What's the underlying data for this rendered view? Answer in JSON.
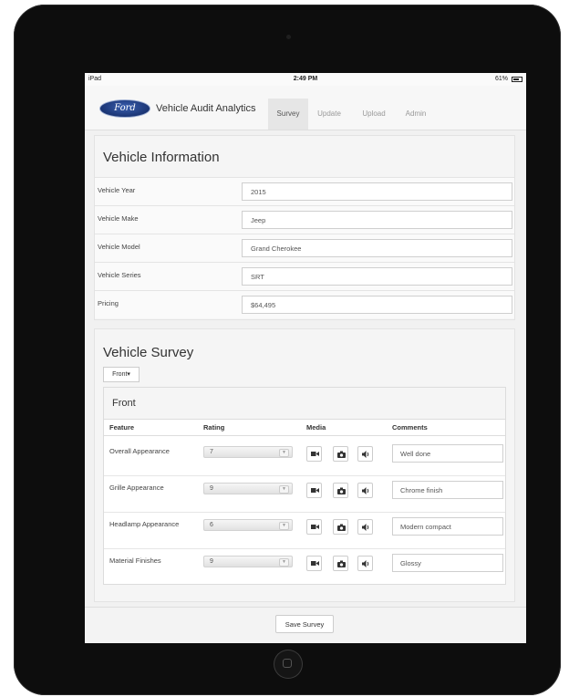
{
  "status_bar": {
    "device": "iPad",
    "time": "2:49 PM",
    "battery": "61%"
  },
  "nav": {
    "brand_logo": "Ford",
    "brand": "Vehicle Audit Analytics",
    "tabs": [
      {
        "label": "Survey",
        "active": true
      },
      {
        "label": "Update",
        "active": false
      },
      {
        "label": "Upload",
        "active": false
      },
      {
        "label": "Admin",
        "active": false
      }
    ]
  },
  "vehicle_info": {
    "title": "Vehicle Information",
    "fields": [
      {
        "label": "Vehicle Year",
        "value": "2015"
      },
      {
        "label": "Vehicle Make",
        "value": "Jeep"
      },
      {
        "label": "Vehicle Model",
        "value": "Grand Cherokee"
      },
      {
        "label": "Vehicle Series",
        "value": "SRT"
      },
      {
        "label": "Pricing",
        "value": "$64,495"
      }
    ]
  },
  "survey": {
    "title": "Vehicle Survey",
    "section_button": "Front▾",
    "card_title": "Front",
    "columns": {
      "feature": "Feature",
      "rating": "Rating",
      "media": "Media",
      "comments": "Comments"
    },
    "rows": [
      {
        "feature": "Overall Appearance",
        "rating": "7",
        "comment": "Well done"
      },
      {
        "feature": "Grille Appearance",
        "rating": "9",
        "comment": "Chrome finish"
      },
      {
        "feature": "Headlamp Appearance",
        "rating": "6",
        "comment": "Modern compact"
      },
      {
        "feature": "Material Finishes",
        "rating": "9",
        "comment": "Glossy"
      }
    ]
  },
  "footer": {
    "save_label": "Save Survey"
  },
  "icons": {
    "video": "video-icon",
    "camera": "camera-icon",
    "audio": "speaker-icon",
    "select": "chevron-down-icon"
  },
  "colors": {
    "ford_blue": "#1b3574",
    "active_tab_bg": "#e6e6e6",
    "page_bg": "#f1f1f1",
    "device_bezel": "#0d0d0d"
  }
}
